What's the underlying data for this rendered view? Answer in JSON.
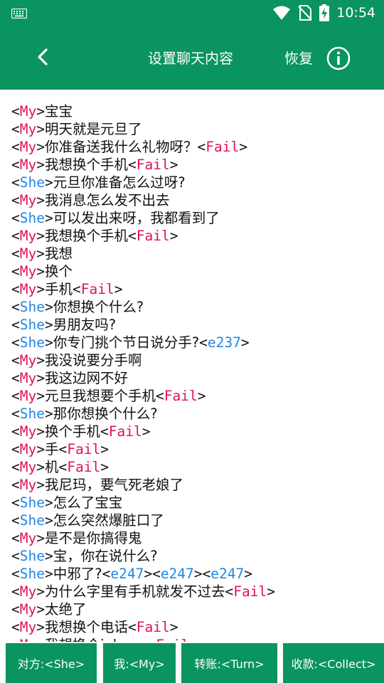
{
  "statusbar": {
    "time": "10:54"
  },
  "appbar": {
    "title": "设置聊天内容",
    "restore_label": "恢复"
  },
  "lines": [
    {
      "who": "My",
      "text": "宝宝"
    },
    {
      "who": "My",
      "text": "明天就是元旦了"
    },
    {
      "who": "My",
      "text": "你准备送我什么礼物呀？",
      "suffix": "Fail"
    },
    {
      "who": "My",
      "text": "我想换个手机",
      "suffix": "Fail"
    },
    {
      "who": "She",
      "text": "元旦你准备怎么过呀?"
    },
    {
      "who": "My",
      "text": "我消息怎么发不出去"
    },
    {
      "who": "She",
      "text": "可以发出来呀，我都看到了"
    },
    {
      "who": "My",
      "text": "我想换个手机",
      "suffix": "Fail"
    },
    {
      "who": "My",
      "text": "我想"
    },
    {
      "who": "My",
      "text": "换个"
    },
    {
      "who": "My",
      "text": "手机",
      "suffix": "Fail"
    },
    {
      "who": "She",
      "text": "你想换个什么?"
    },
    {
      "who": "She",
      "text": "男朋友吗?"
    },
    {
      "who": "She",
      "text": "你专门挑个节日说分手?",
      "suffix": "e237"
    },
    {
      "who": "My",
      "text": "我没说要分手啊"
    },
    {
      "who": "My",
      "text": "我这边网不好"
    },
    {
      "who": "My",
      "text": "元旦我想要个手机",
      "suffix": "Fail"
    },
    {
      "who": "She",
      "text": "那你想换个什么?"
    },
    {
      "who": "My",
      "text": "换个手机",
      "suffix": "Fail"
    },
    {
      "who": "My",
      "text": "手",
      "suffix": "Fail"
    },
    {
      "who": "My",
      "text": "机",
      "suffix": "Fail"
    },
    {
      "who": "My",
      "text": "我尼玛，要气死老娘了"
    },
    {
      "who": "She",
      "text": "怎么了宝宝"
    },
    {
      "who": "She",
      "text": "怎么突然爆脏口了"
    },
    {
      "who": "My",
      "text": "是不是你搞得鬼"
    },
    {
      "who": "She",
      "text": "宝，你在说什么?"
    },
    {
      "who": "She",
      "text": "中邪了?",
      "suffixes": [
        "e247",
        "e247",
        "e247"
      ]
    },
    {
      "who": "My",
      "text": "为什么字里有手机就发不过去",
      "suffix": "Fail"
    },
    {
      "who": "My",
      "text": "太绝了"
    },
    {
      "who": "My",
      "text": "我想换个电话",
      "suffix": "Fail"
    },
    {
      "who": "My",
      "text": "我想换个iphone",
      "suffix": "Fail"
    }
  ],
  "buttons": [
    {
      "label": "对方:<She>"
    },
    {
      "label": "我:<My>"
    },
    {
      "label": "转账:<Turn>"
    },
    {
      "label": "收款:<Collect>"
    }
  ],
  "colors": {
    "primary": "#0a9460",
    "my_tag": "#e0105a",
    "she_tag": "#1e88e5",
    "fail_tag": "#e0105a",
    "emoji_tag": "#1e88e5"
  }
}
